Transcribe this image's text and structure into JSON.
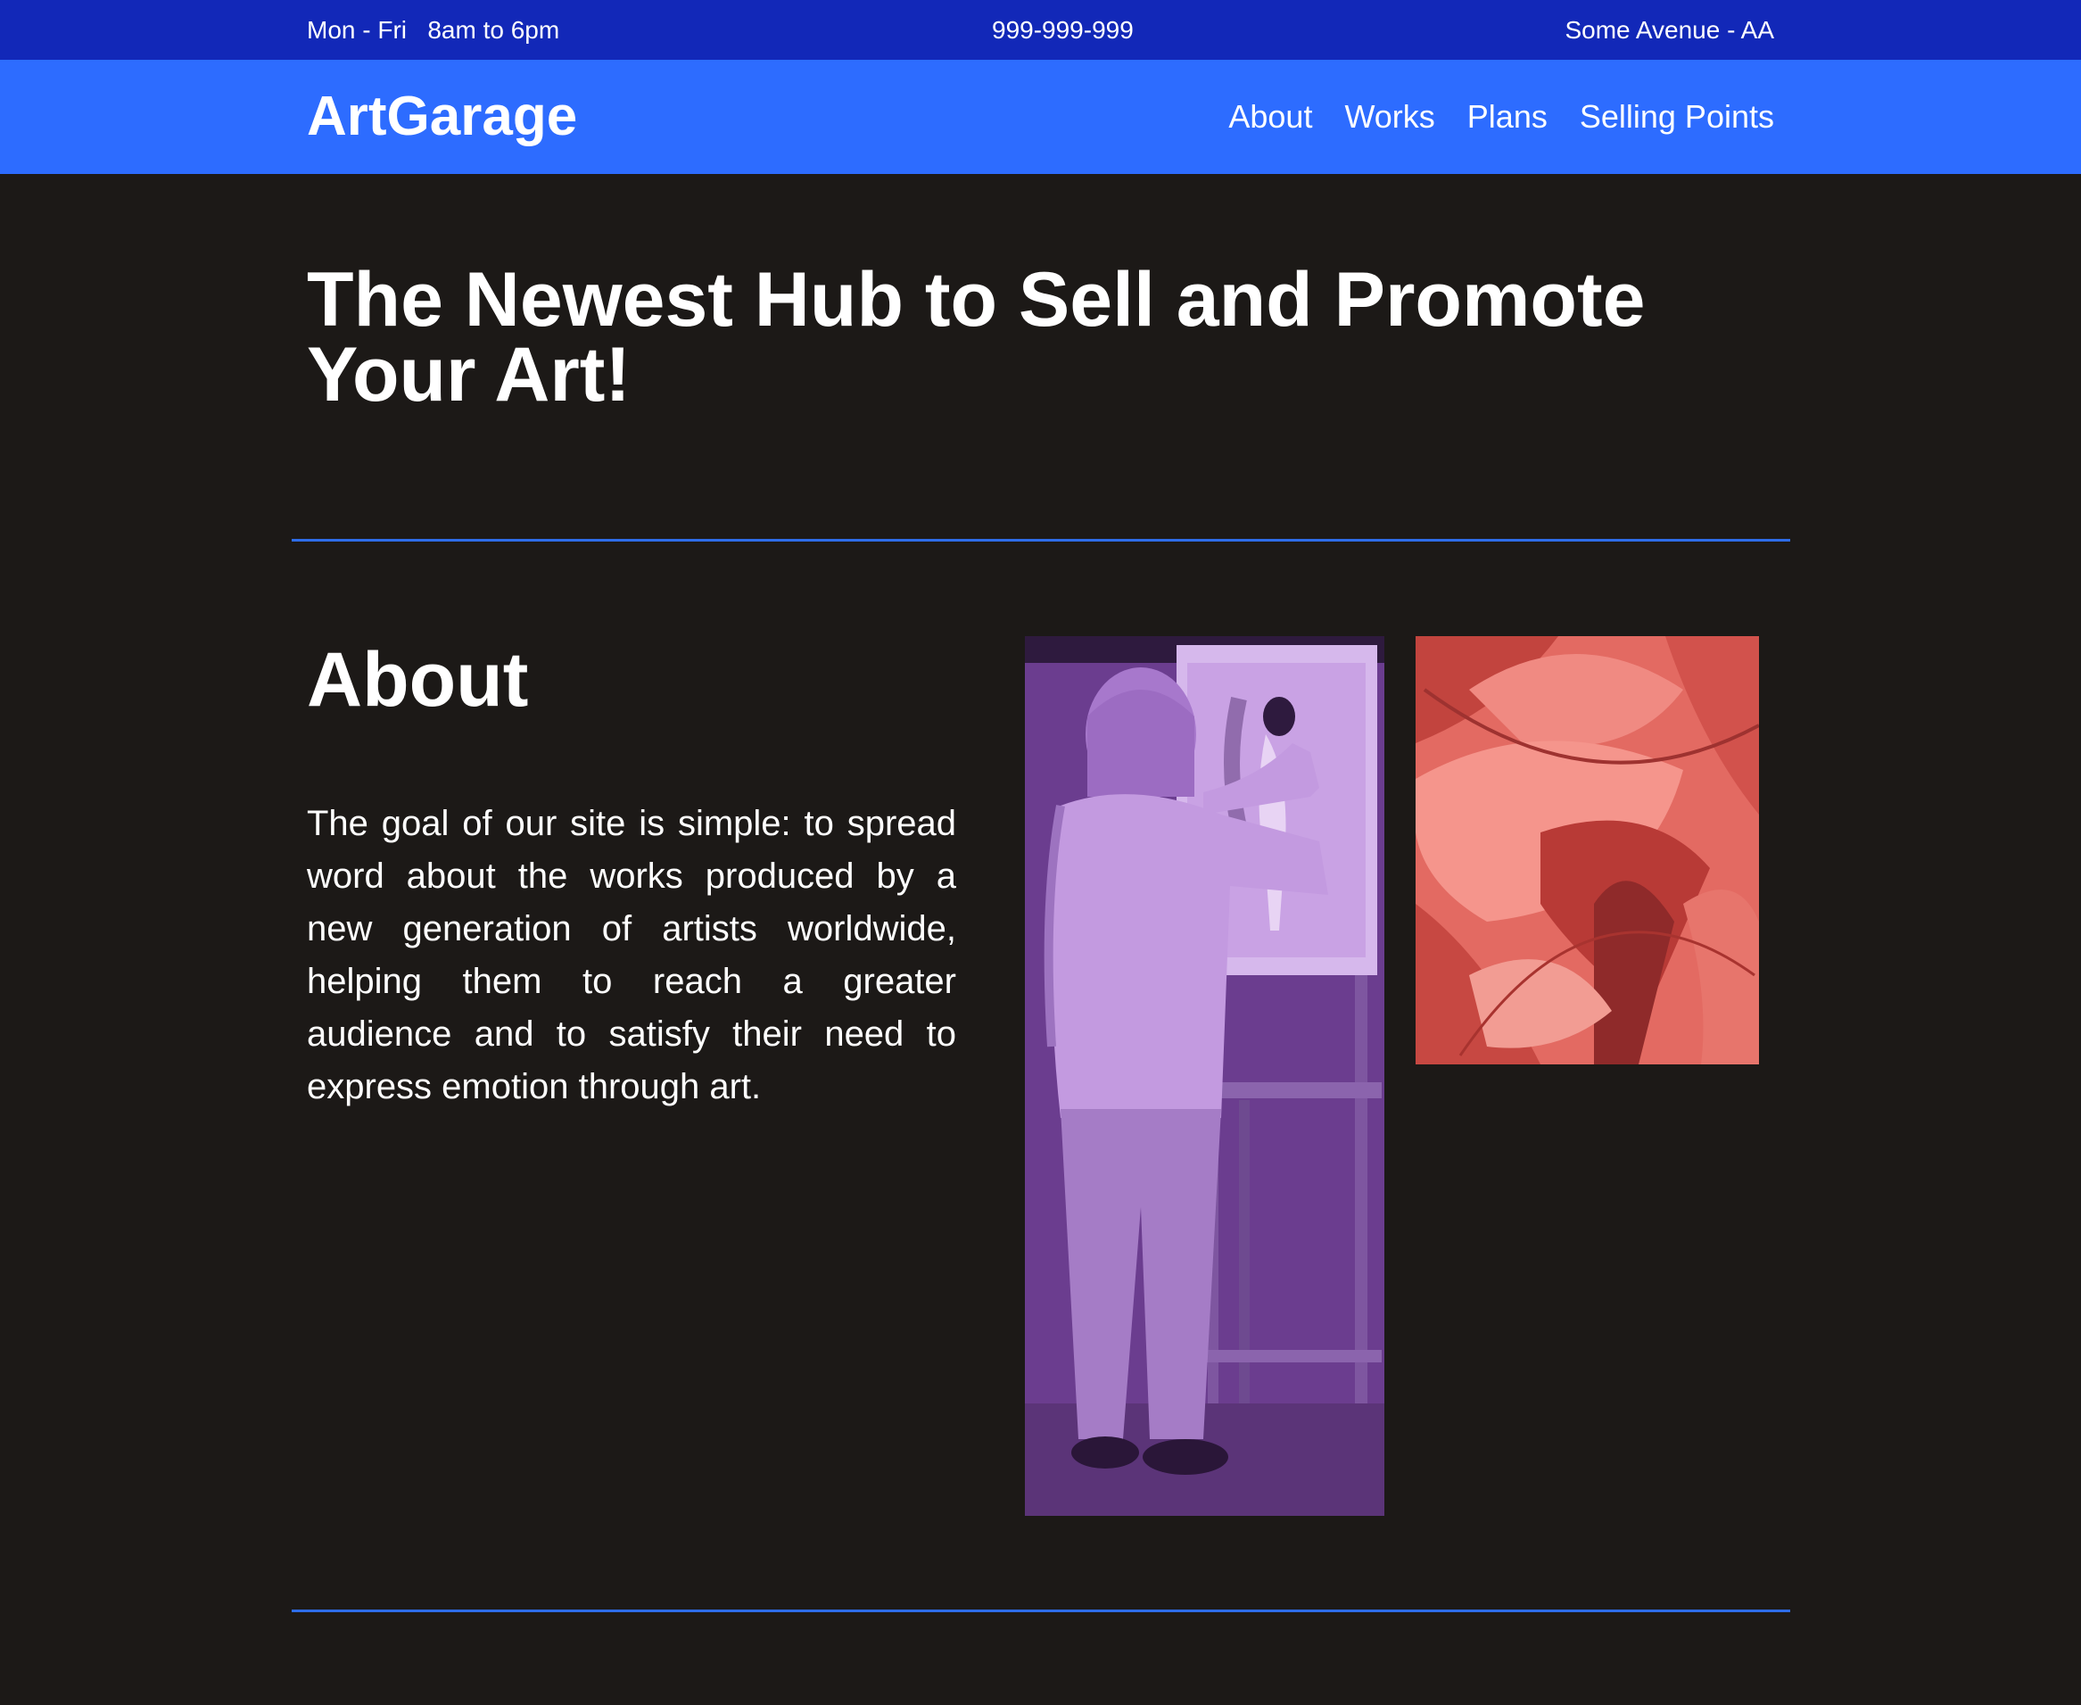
{
  "topbar": {
    "hours": "Mon - Fri   8am to 6pm",
    "phone": "999-999-999",
    "address": "Some Avenue - AA"
  },
  "header": {
    "logo": "ArtGarage",
    "nav": [
      "About",
      "Works",
      "Plans",
      "Selling Points"
    ]
  },
  "hero": {
    "title": "The Newest Hub to Sell and Promote Your Art!"
  },
  "about": {
    "heading": "About",
    "body": "The goal of our site is simple: to spread word about the works produced by a new generation of artists worldwide, helping them to reach a greater audience and to satisfy their need to express emotion through art."
  },
  "colors": {
    "topbar": "#1228b8",
    "navbar": "#2d6cff",
    "background": "#1c1917",
    "divider": "#2e6ce8"
  }
}
